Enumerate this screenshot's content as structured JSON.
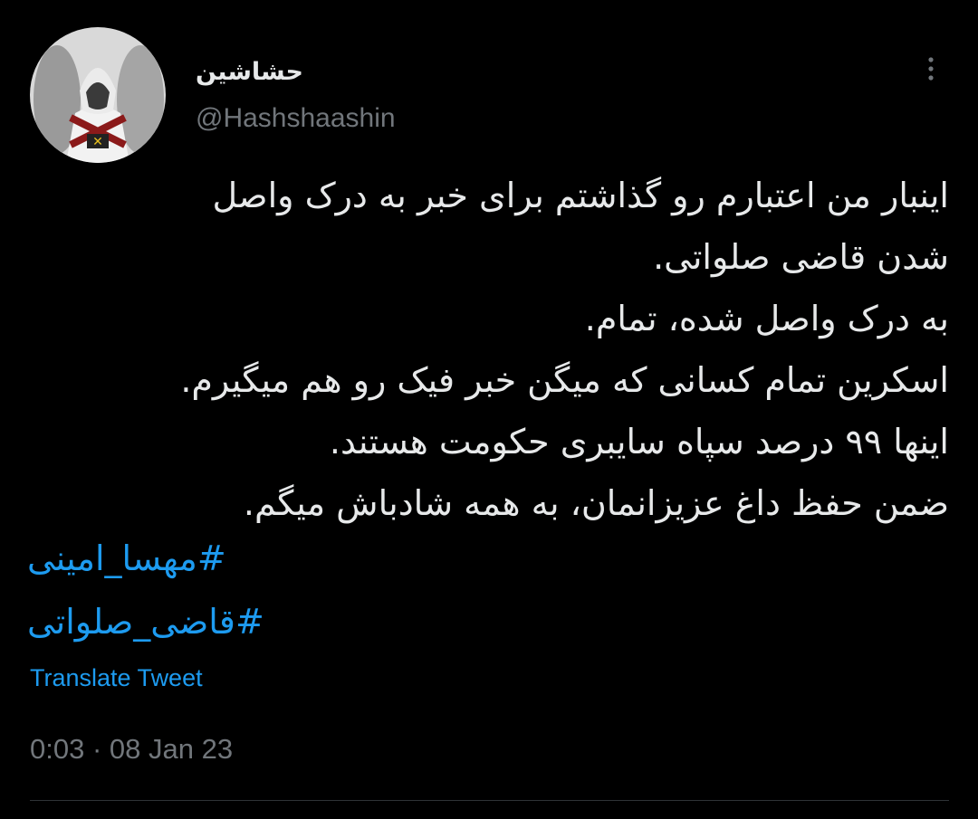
{
  "user": {
    "display_name": "حشاشین",
    "handle": "@Hashshaashin",
    "avatar_icon": "assassin-avatar-icon"
  },
  "tweet": {
    "lines": [
      "اینبار من اعتبارم رو گذاشتم برای خبر به درک واصل",
      "شدن قاضی صلواتی.",
      "به درک واصل شده، تمام.",
      "اسکرین تمام کسانی که میگن خبر فیک رو هم میگیرم.",
      "اینها ۹۹ درصد سپاه سایبری حکومت هستند.",
      "ضمن حفظ داغ عزیزانمان، به همه شادباش میگم."
    ],
    "hashtags": [
      "#مهسا_امینی",
      "#قاضی_صلواتی"
    ],
    "translate_label": "Translate Tweet",
    "time": "0:03",
    "separator": "·",
    "date": "08 Jan 23"
  },
  "icons": {
    "more": "more-options-icon"
  },
  "colors": {
    "background": "#000000",
    "text": "#e7e9ea",
    "secondary": "#71767b",
    "link": "#1d9bf0",
    "divider": "#2f3336"
  }
}
